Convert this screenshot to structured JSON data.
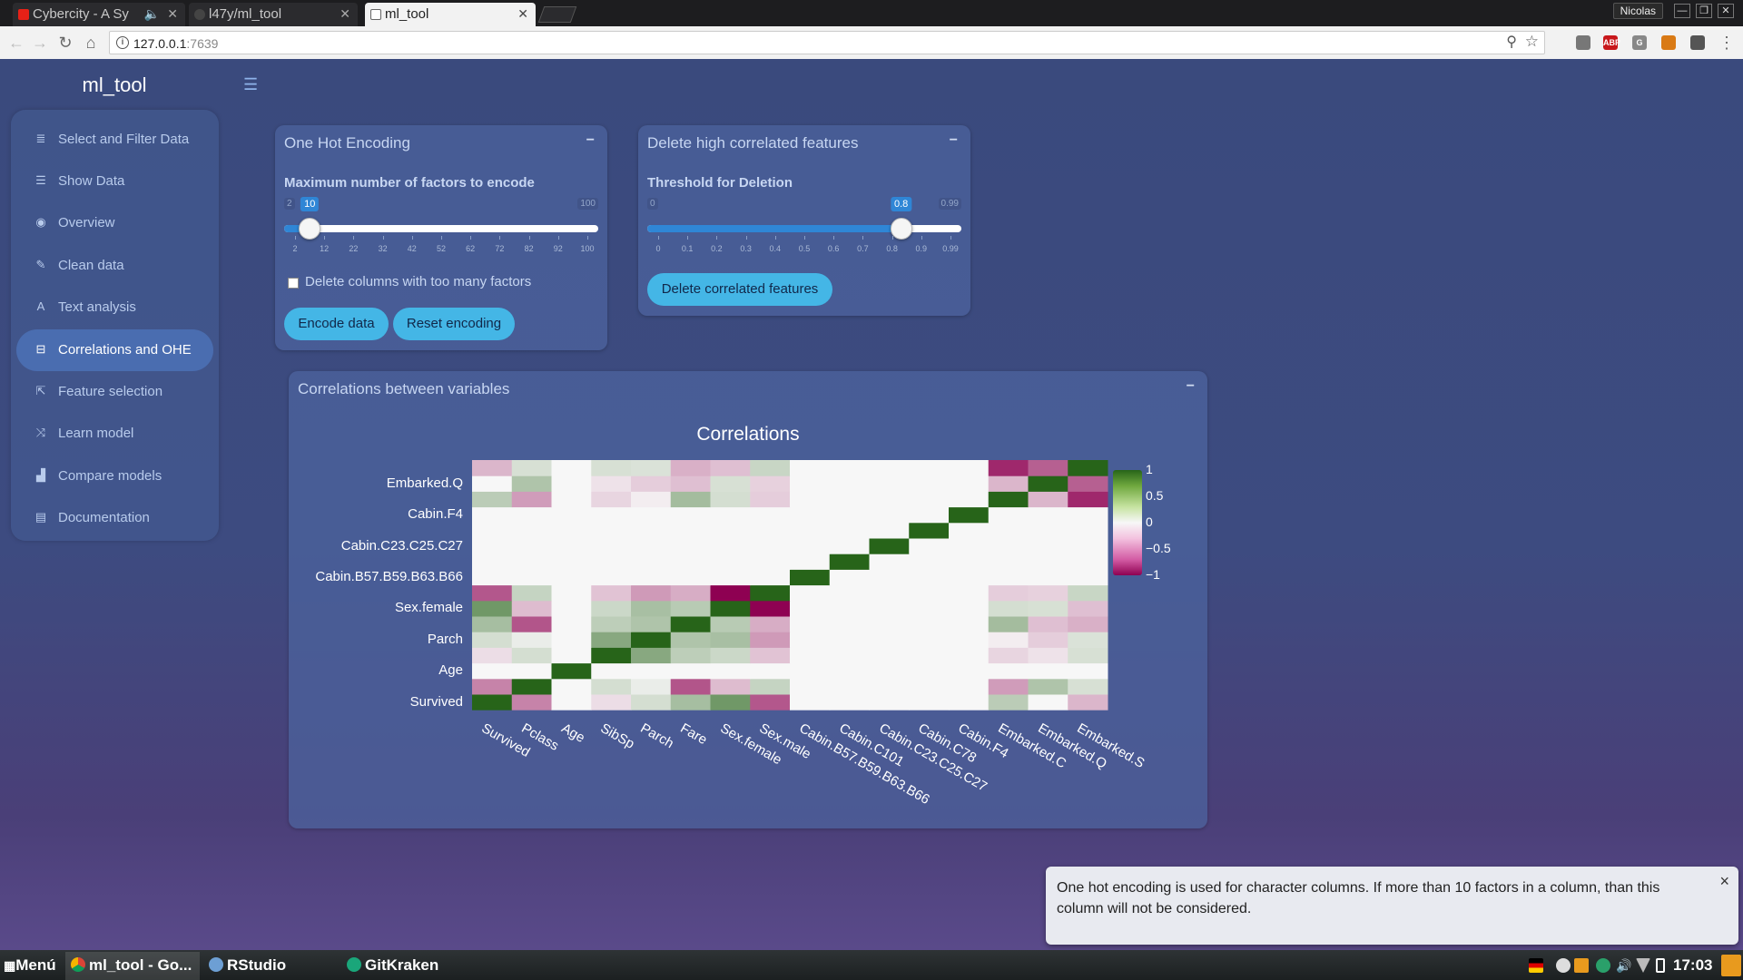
{
  "browser": {
    "tabs": [
      {
        "title": "Cybercity - A Sy",
        "favicon_color": "#e62117"
      },
      {
        "title": "l47y/ml_tool",
        "favicon_color": "#444444"
      },
      {
        "title": "ml_tool",
        "favicon_color": "#666666"
      }
    ],
    "profile": "Nicolas",
    "url_host": "127.0.0.1",
    "url_port": ":7639",
    "info_glyph": "i",
    "window_buttons": [
      "—",
      "❐",
      "✕"
    ],
    "extensions": [
      "ABP",
      "G"
    ]
  },
  "app": {
    "brand": "ml_tool",
    "sidebar": {
      "items": [
        {
          "label": "Select and Filter Data",
          "icon": "database-icon",
          "glyph": "≣"
        },
        {
          "label": "Show Data",
          "icon": "table-icon",
          "glyph": "☰"
        },
        {
          "label": "Overview",
          "icon": "eye-icon",
          "glyph": "◉"
        },
        {
          "label": "Clean data",
          "icon": "wrench-icon",
          "glyph": "✎"
        },
        {
          "label": "Text analysis",
          "icon": "font-icon",
          "glyph": "A"
        },
        {
          "label": "Correlations and OHE",
          "icon": "sliders-icon",
          "glyph": "⊟",
          "active": true
        },
        {
          "label": "Feature selection",
          "icon": "external-link-icon",
          "glyph": "⇱"
        },
        {
          "label": "Learn model",
          "icon": "random-icon",
          "glyph": "⤨"
        },
        {
          "label": "Compare models",
          "icon": "bar-chart-icon",
          "glyph": "▟"
        },
        {
          "label": "Documentation",
          "icon": "list-icon",
          "glyph": "▤"
        }
      ]
    },
    "ohe": {
      "title": "One Hot Encoding",
      "slider_label": "Maximum number of factors to encode",
      "slider": {
        "min": 2,
        "max": 100,
        "value": 10,
        "min_label": "2",
        "max_label": "100",
        "value_label": "10",
        "ticks": [
          "2",
          "12",
          "22",
          "32",
          "42",
          "52",
          "62",
          "72",
          "82",
          "92",
          "100"
        ]
      },
      "checkbox_label": "Delete columns with too many factors",
      "checked": false,
      "encode_button": "Encode data",
      "reset_button": "Reset encoding"
    },
    "corr_delete": {
      "title": "Delete high correlated features",
      "slider_label": "Threshold for Deletion",
      "slider": {
        "min": 0,
        "max": 0.99,
        "value": 0.8,
        "min_label": "0",
        "max_label": "0.99",
        "value_label": "0.8",
        "ticks": [
          "0",
          "0.1",
          "0.2",
          "0.3",
          "0.4",
          "0.5",
          "0.6",
          "0.7",
          "0.8",
          "0.9",
          "0.99"
        ]
      },
      "delete_button": "Delete correlated features"
    },
    "correlations_box": {
      "title": "Correlations between variables"
    },
    "notification": {
      "text": "One hot encoding is used for character columns. If more than 10 factors in a column, than this column will not be considered.",
      "close": "×"
    }
  },
  "chart_data": {
    "type": "heatmap",
    "title": "Correlations",
    "variables": [
      "Survived",
      "Pclass",
      "Age",
      "SibSp",
      "Parch",
      "Fare",
      "Sex.female",
      "Sex.male",
      "Cabin.B57.B59.B63.B66",
      "Cabin.C101",
      "Cabin.C23.C25.C27",
      "Cabin.C78",
      "Cabin.F4",
      "Embarked.C",
      "Embarked.Q",
      "Embarked.S"
    ],
    "y_tick_labels": [
      "Survived",
      "Age",
      "Parch",
      "Sex.female",
      "Cabin.B57.B59.B63.B66",
      "Cabin.C23.C25.C27",
      "Cabin.F4",
      "Embarked.Q"
    ],
    "x_tick_labels": [
      "Survived",
      "Pclass",
      "Age",
      "SibSp",
      "Parch",
      "Fare",
      "Sex.female",
      "Sex.male",
      "Cabin.B57.B59.B63.B66",
      "Cabin.C101",
      "Cabin.C23.C25.C27",
      "Cabin.C78",
      "Cabin.F4",
      "Embarked.C",
      "Embarked.Q",
      "Embarked.S"
    ],
    "matrix": [
      [
        1,
        -0.34,
        0,
        -0.04,
        0.08,
        0.26,
        0.54,
        -0.54,
        0,
        0,
        0,
        0,
        0,
        0.17,
        0,
        -0.15
      ],
      [
        -0.34,
        1,
        0,
        0.08,
        0.02,
        -0.55,
        -0.13,
        0.13,
        0,
        0,
        0,
        0,
        0,
        -0.24,
        0.22,
        0.07
      ],
      [
        0,
        0,
        1,
        0,
        0,
        0,
        0,
        0,
        0,
        0,
        0,
        0,
        0,
        0,
        0,
        0
      ],
      [
        -0.04,
        0.08,
        0,
        1,
        0.41,
        0.16,
        0.11,
        -0.11,
        0,
        0,
        0,
        0,
        0,
        -0.06,
        -0.03,
        0.07
      ],
      [
        0.08,
        0.02,
        0,
        0.41,
        1,
        0.22,
        0.25,
        -0.25,
        0,
        0,
        0,
        0,
        0,
        -0.01,
        -0.08,
        0.06
      ],
      [
        0.26,
        -0.55,
        0,
        0.16,
        0.22,
        1,
        0.18,
        -0.18,
        0,
        0,
        0,
        0,
        0,
        0.27,
        -0.12,
        -0.17
      ],
      [
        0.54,
        -0.13,
        0,
        0.11,
        0.25,
        0.18,
        1,
        -1,
        0,
        0,
        0,
        0,
        0,
        0.08,
        0.07,
        -0.12
      ],
      [
        -0.54,
        0.13,
        0,
        -0.11,
        -0.25,
        -0.18,
        -1,
        1,
        0,
        0,
        0,
        0,
        0,
        -0.08,
        -0.07,
        0.12
      ],
      [
        0,
        0,
        0,
        0,
        0,
        0,
        0,
        0,
        1,
        0,
        0,
        0,
        0,
        0,
        0,
        0
      ],
      [
        0,
        0,
        0,
        0,
        0,
        0,
        0,
        0,
        0,
        1,
        0,
        0,
        0,
        0,
        0,
        0
      ],
      [
        0,
        0,
        0,
        0,
        0,
        0,
        0,
        0,
        0,
        0,
        1,
        0,
        0,
        0,
        0,
        0
      ],
      [
        0,
        0,
        0,
        0,
        0,
        0,
        0,
        0,
        0,
        0,
        0,
        1,
        0,
        0,
        0,
        0
      ],
      [
        0,
        0,
        0,
        0,
        0,
        0,
        0,
        0,
        0,
        0,
        0,
        0,
        1,
        0,
        0,
        0
      ],
      [
        0.17,
        -0.24,
        0,
        -0.06,
        -0.01,
        0.27,
        0.08,
        -0.08,
        0,
        0,
        0,
        0,
        0,
        1,
        -0.15,
        -0.78
      ],
      [
        0,
        0.22,
        0,
        -0.03,
        -0.08,
        -0.12,
        0.07,
        -0.07,
        0,
        0,
        0,
        0,
        0,
        -0.15,
        1,
        -0.5
      ],
      [
        -0.15,
        0.07,
        0,
        0.07,
        0.06,
        -0.17,
        -0.12,
        0.12,
        0,
        0,
        0,
        0,
        0,
        -0.78,
        -0.5,
        1
      ]
    ],
    "zlim": [
      -1,
      1
    ],
    "colorbar_ticks": [
      "1",
      "0.5",
      "0",
      "−0.5",
      "−1"
    ],
    "colorscale": [
      "#8e0152",
      "#f7f7f7",
      "#276419"
    ]
  },
  "taskbar": {
    "items": [
      {
        "label": "Menú",
        "icon": "menu-icon"
      },
      {
        "label": "ml_tool - Go...",
        "icon": "chrome-icon"
      },
      {
        "label": "RStudio",
        "icon": "rstudio-icon"
      },
      {
        "label": "GitKraken",
        "icon": "gitkraken-icon"
      }
    ],
    "clock": "17:03"
  }
}
